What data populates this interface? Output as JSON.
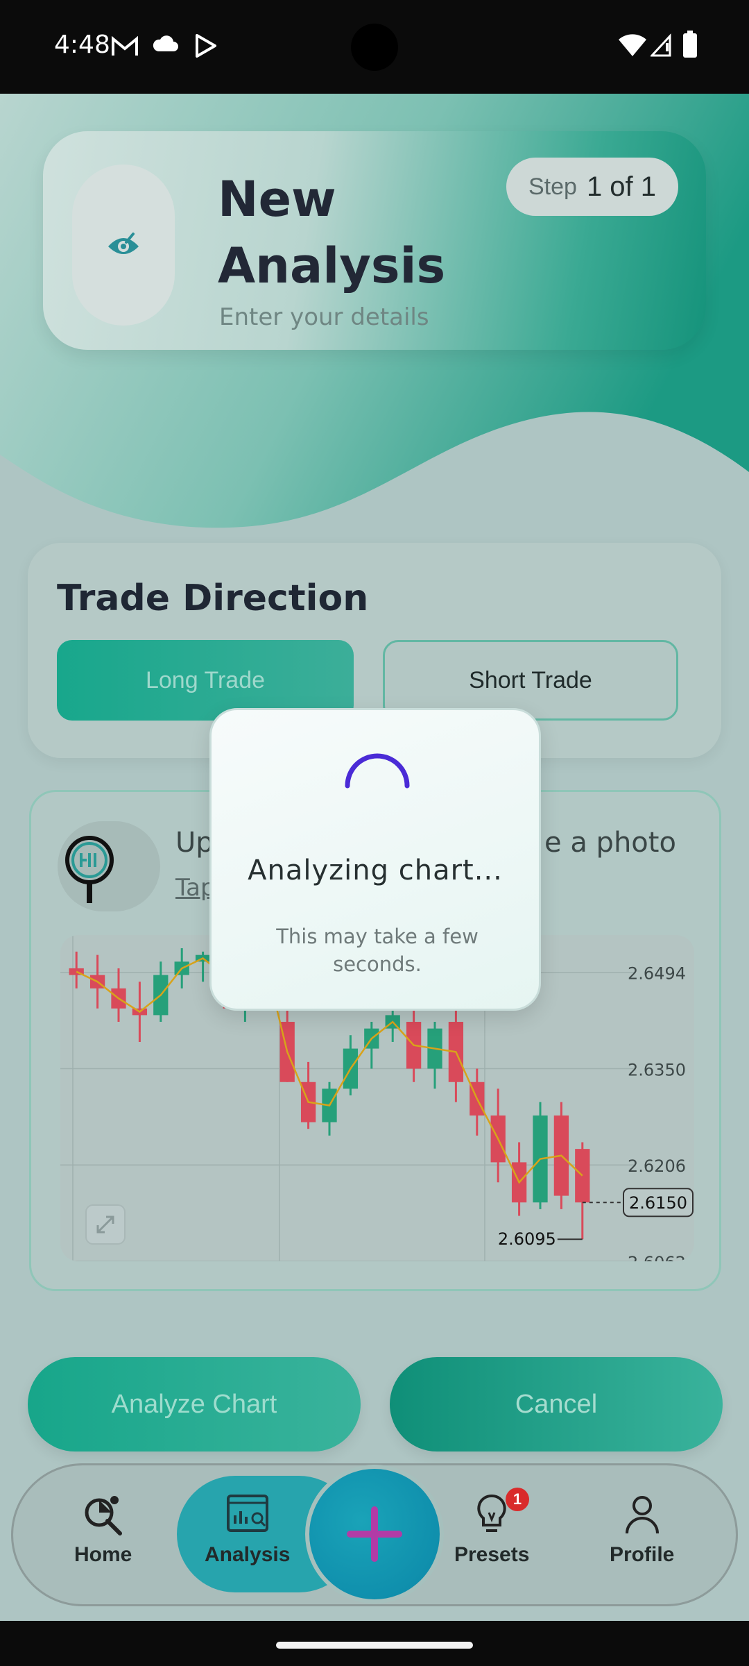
{
  "status_bar": {
    "time": "4:48",
    "left_icons": [
      "gmail-icon",
      "cloud-icon",
      "play-store-icon"
    ],
    "right_icons": [
      "wifi-icon",
      "signal-icon",
      "battery-icon"
    ]
  },
  "header": {
    "title_line1": "New",
    "title_line2": "Analysis",
    "subtitle": "Enter your details",
    "step_word": "Step",
    "step_value": "1 of 1",
    "icon": "eye-icon"
  },
  "trade_direction": {
    "title": "Trade Direction",
    "long_label": "Long Trade",
    "short_label": "Short Trade",
    "selected": "Long Trade"
  },
  "upload": {
    "text_left": "Up",
    "text_right": "e a photo",
    "link_text": "Tap"
  },
  "chart_data": {
    "type": "candlestick",
    "y_ticks": [
      "2.6494",
      "2.6350",
      "2.6206",
      "2.6062"
    ],
    "current_price_label": "2.6150",
    "low_label": "2.6095",
    "ylim": [
      2.6062,
      2.654
    ],
    "candles": [
      {
        "o": 2.65,
        "h": 2.6525,
        "l": 2.647,
        "c": 2.649
      },
      {
        "o": 2.649,
        "h": 2.652,
        "l": 2.644,
        "c": 2.647
      },
      {
        "o": 2.647,
        "h": 2.65,
        "l": 2.642,
        "c": 2.644
      },
      {
        "o": 2.644,
        "h": 2.648,
        "l": 2.639,
        "c": 2.643
      },
      {
        "o": 2.643,
        "h": 2.651,
        "l": 2.642,
        "c": 2.649
      },
      {
        "o": 2.649,
        "h": 2.653,
        "l": 2.647,
        "c": 2.651
      },
      {
        "o": 2.651,
        "h": 2.6525,
        "l": 2.648,
        "c": 2.652
      },
      {
        "o": 2.652,
        "h": 2.653,
        "l": 2.644,
        "c": 2.646
      },
      {
        "o": 2.646,
        "h": 2.65,
        "l": 2.642,
        "c": 2.649
      },
      {
        "o": 2.649,
        "h": 2.653,
        "l": 2.647,
        "c": 2.652
      },
      {
        "o": 2.642,
        "h": 2.645,
        "l": 2.633,
        "c": 2.633
      },
      {
        "o": 2.633,
        "h": 2.636,
        "l": 2.626,
        "c": 2.627
      },
      {
        "o": 2.627,
        "h": 2.633,
        "l": 2.625,
        "c": 2.632
      },
      {
        "o": 2.632,
        "h": 2.64,
        "l": 2.631,
        "c": 2.638
      },
      {
        "o": 2.638,
        "h": 2.642,
        "l": 2.635,
        "c": 2.641
      },
      {
        "o": 2.641,
        "h": 2.644,
        "l": 2.639,
        "c": 2.643
      },
      {
        "o": 2.642,
        "h": 2.645,
        "l": 2.633,
        "c": 2.635
      },
      {
        "o": 2.635,
        "h": 2.642,
        "l": 2.632,
        "c": 2.641
      },
      {
        "o": 2.642,
        "h": 2.644,
        "l": 2.63,
        "c": 2.633
      },
      {
        "o": 2.633,
        "h": 2.635,
        "l": 2.625,
        "c": 2.628
      },
      {
        "o": 2.628,
        "h": 2.632,
        "l": 2.618,
        "c": 2.621
      },
      {
        "o": 2.621,
        "h": 2.624,
        "l": 2.613,
        "c": 2.615
      },
      {
        "o": 2.615,
        "h": 2.63,
        "l": 2.614,
        "c": 2.628
      },
      {
        "o": 2.628,
        "h": 2.63,
        "l": 2.614,
        "c": 2.616
      },
      {
        "o": 2.623,
        "h": 2.624,
        "l": 2.6095,
        "c": 2.615
      }
    ],
    "ma_color": "#d8a31a",
    "up_color": "#26a07a",
    "down_color": "#d94a5a"
  },
  "actions": {
    "analyze_label": "Analyze Chart",
    "cancel_label": "Cancel"
  },
  "nav": {
    "home": "Home",
    "analysis": "Analysis",
    "presets": "Presets",
    "profile": "Profile",
    "presets_badge": "1",
    "active": "Analysis"
  },
  "dialog": {
    "title": "Analyzing chart...",
    "subtitle": "This may take a few seconds."
  },
  "colors": {
    "accent": "#15937b",
    "spinner": "#4a2bd6",
    "fab_plus": "#b23ba6"
  }
}
